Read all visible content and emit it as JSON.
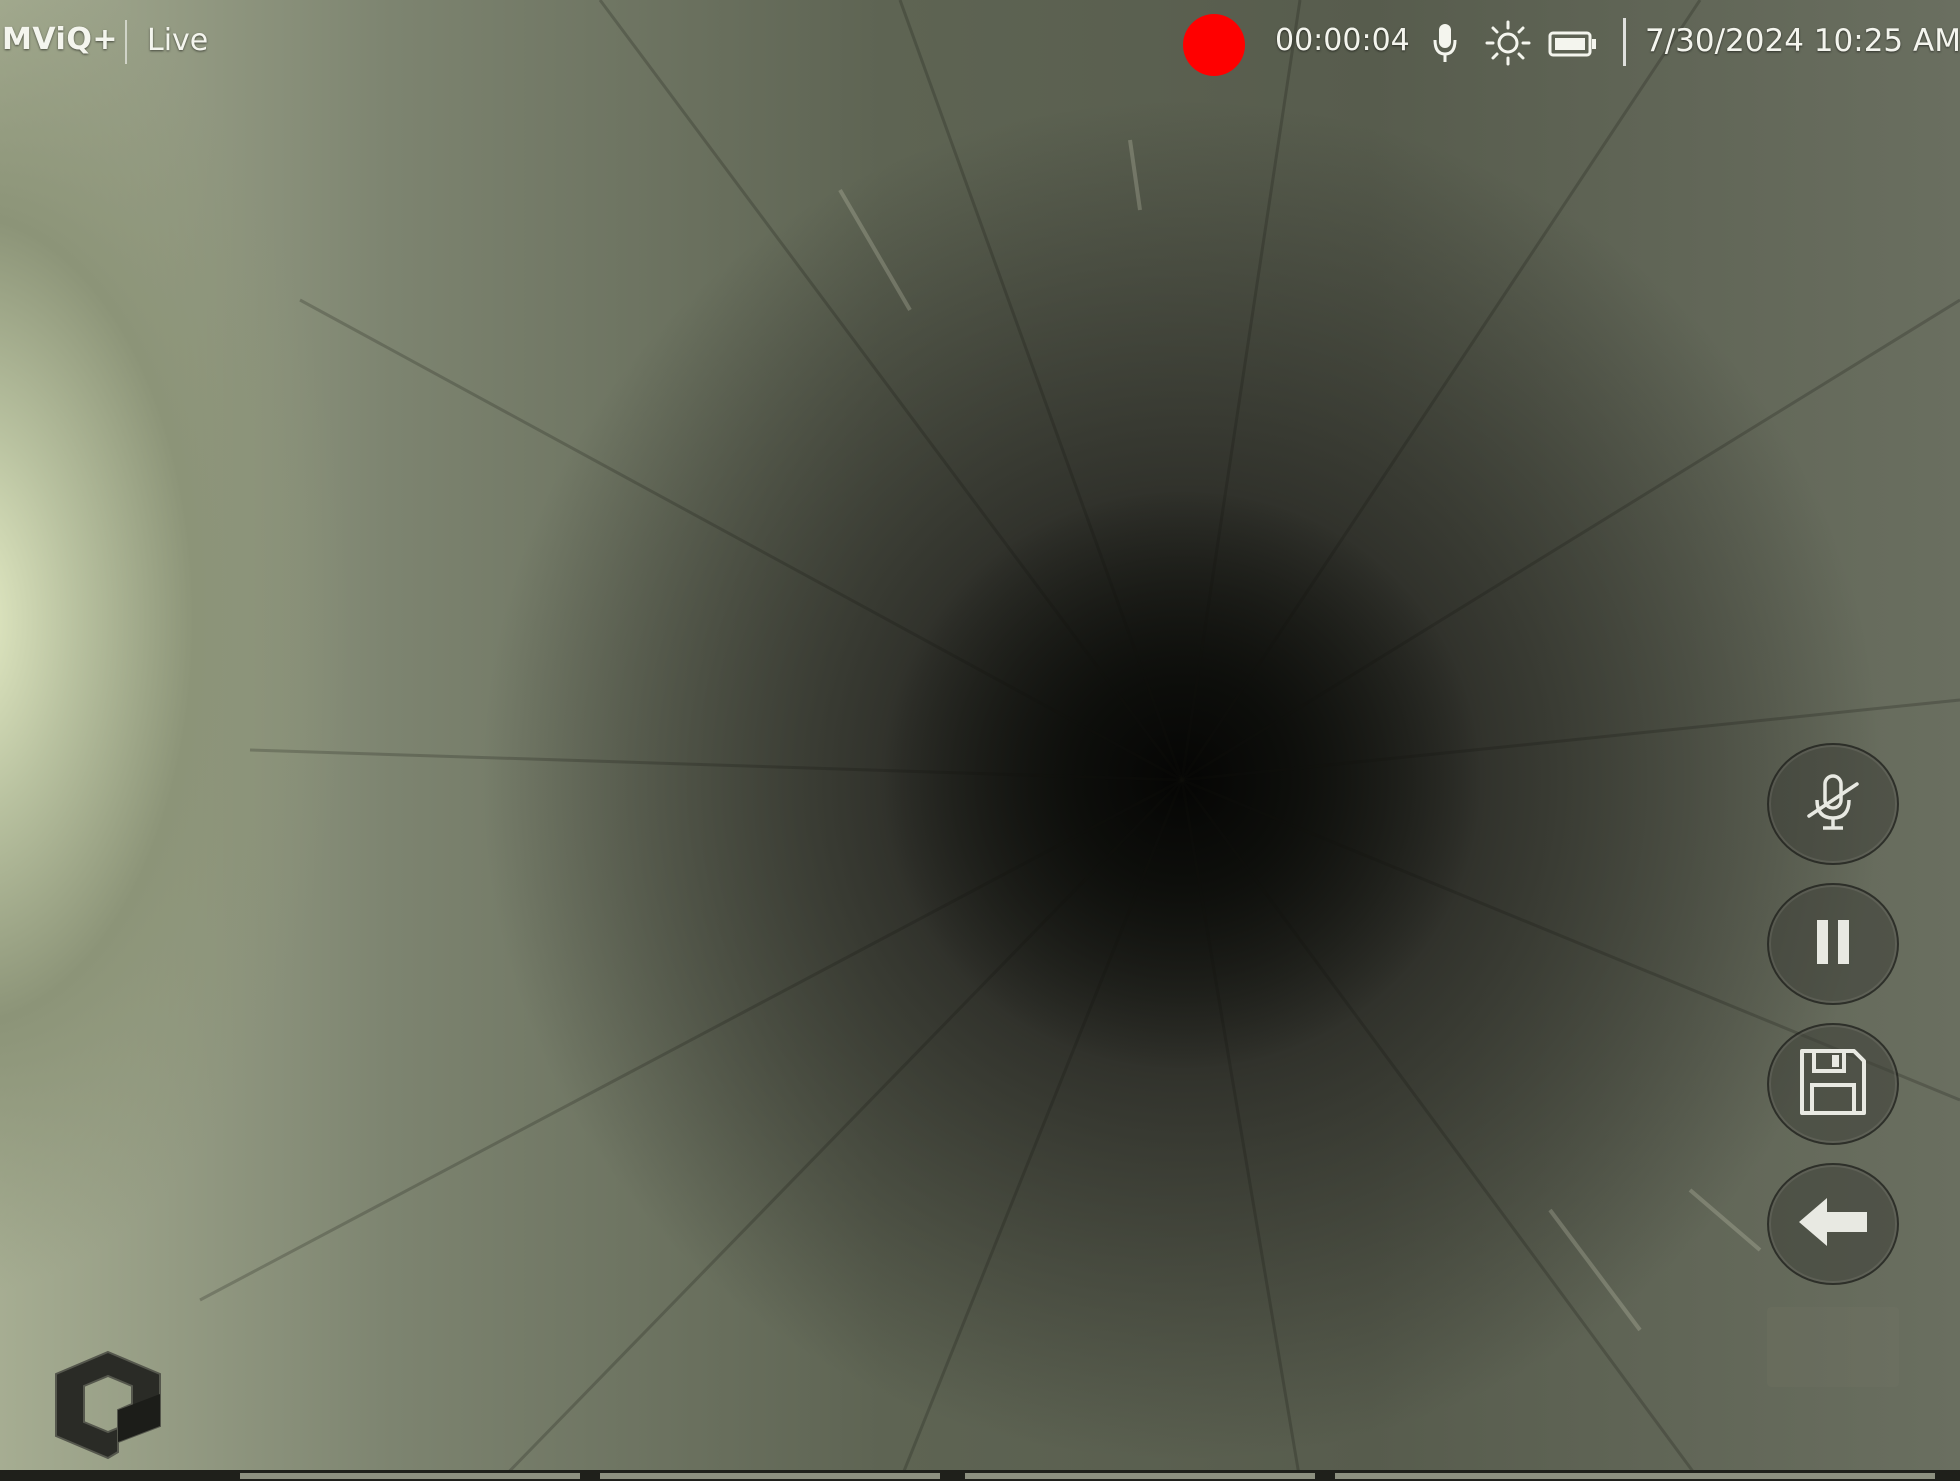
{
  "status_bar": {
    "brand": "MViQ+",
    "mode": "Live",
    "recording_color": "#ff0000",
    "elapsed": "00:00:04",
    "icons": [
      "microphone-icon",
      "brightness-icon",
      "battery-icon"
    ],
    "datetime": "7/30/2024 10:25 AM"
  },
  "controls": [
    {
      "name": "mute-microphone-button",
      "icon": "microphone-muted-icon"
    },
    {
      "name": "pause-recording-button",
      "icon": "pause-icon"
    },
    {
      "name": "save-button",
      "icon": "floppy-disk-icon"
    },
    {
      "name": "back-button",
      "icon": "arrow-left-icon"
    }
  ],
  "colors": {
    "text": "#f4f5ee",
    "button_fill": "rgba(60,62,54,0.55)",
    "icon": "#e8e9e2"
  }
}
